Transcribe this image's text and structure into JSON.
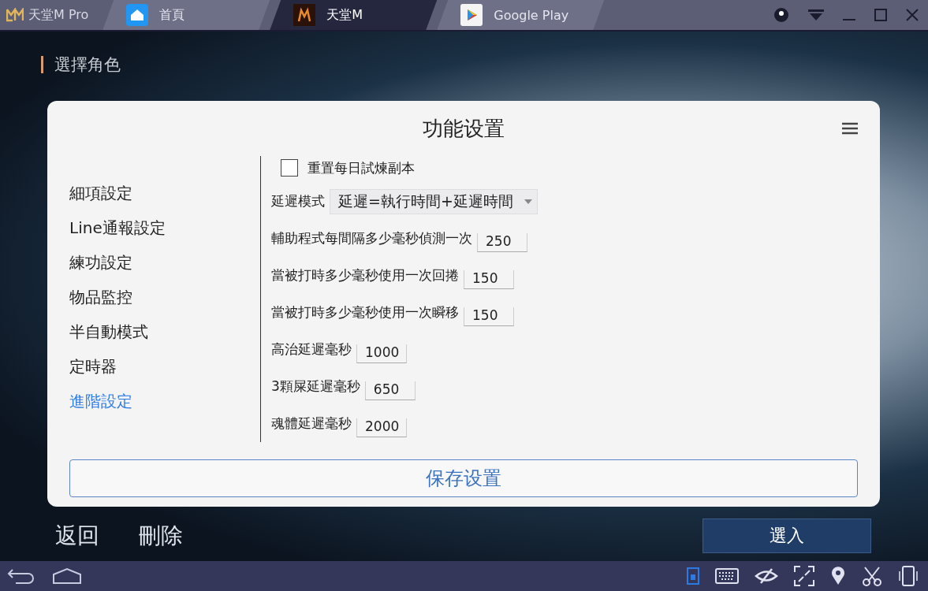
{
  "window": {
    "app_name": "天堂M Pro"
  },
  "tabs": [
    {
      "label": "首頁",
      "selected": false,
      "kind": "home"
    },
    {
      "label": "天堂M",
      "selected": true,
      "kind": "game"
    },
    {
      "label": "Google Play",
      "selected": false,
      "kind": "store"
    }
  ],
  "game": {
    "title": "選擇角色",
    "bottom_buttons": [
      "返回",
      "刪除"
    ],
    "enter_button": "選入"
  },
  "dialog": {
    "title": "功能设置",
    "menu": [
      {
        "label": "細項設定",
        "selected": false
      },
      {
        "label": "Line通報設定",
        "selected": false
      },
      {
        "label": "練功設定",
        "selected": false
      },
      {
        "label": "物品監控",
        "selected": false
      },
      {
        "label": "半自動模式",
        "selected": false
      },
      {
        "label": "定時器",
        "selected": false
      },
      {
        "label": "進階設定",
        "selected": true
      }
    ],
    "checkbox": {
      "label": "重置每日試煉副本",
      "checked": false
    },
    "select": {
      "label": "延遲模式",
      "value": "延遲=執行時間+延遲時間"
    },
    "fields": [
      {
        "label": "輔助程式每間隔多少毫秒偵測一次",
        "value": "250"
      },
      {
        "label": "當被打時多少毫秒使用一次回捲",
        "value": "150"
      },
      {
        "label": "當被打時多少毫秒使用一次瞬移",
        "value": "150"
      },
      {
        "label": "高治延遲毫秒",
        "value": "1000"
      },
      {
        "label": "3顆屎延遲毫秒",
        "value": "650"
      },
      {
        "label": "魂體延遲毫秒",
        "value": "2000"
      }
    ],
    "save_button": "保存设置"
  }
}
